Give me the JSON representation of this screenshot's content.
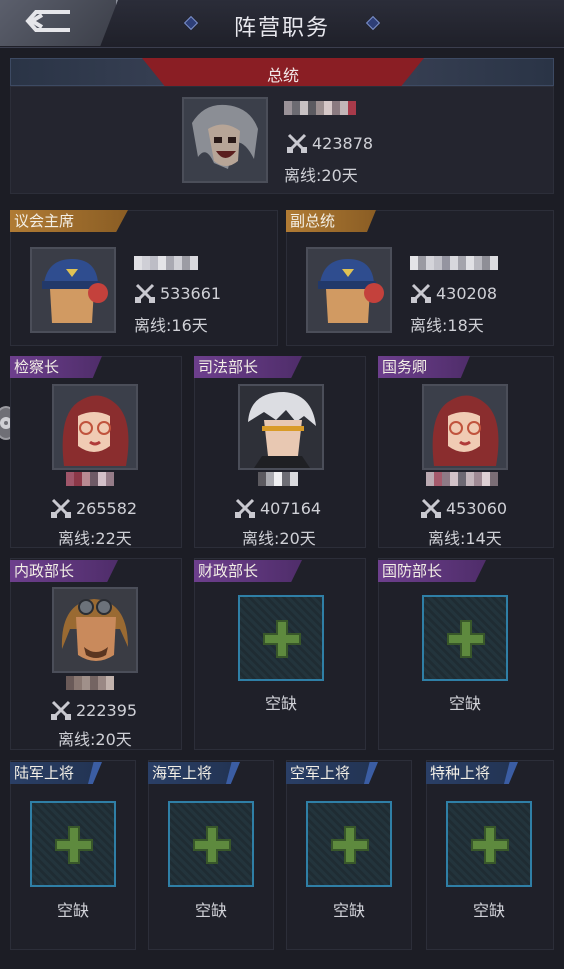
{
  "header": {
    "title": "阵营职务",
    "back_icon": "back-arrow-icon"
  },
  "leader": {
    "title": "总统",
    "power": "423878",
    "offline": "离线:20天"
  },
  "council": [
    {
      "role": "议会主席",
      "power": "533661",
      "offline": "离线:16天"
    },
    {
      "role": "副总统",
      "power": "430208",
      "offline": "离线:18天"
    }
  ],
  "ministers": [
    {
      "role": "检察长",
      "power": "265582",
      "offline": "离线:22天"
    },
    {
      "role": "司法部长",
      "power": "407164",
      "offline": "离线:20天"
    },
    {
      "role": "国务卿",
      "power": "453060",
      "offline": "离线:14天"
    },
    {
      "role": "内政部长",
      "power": "222395",
      "offline": "离线:20天"
    },
    {
      "role": "财政部长",
      "vacant": "空缺"
    },
    {
      "role": "国防部长",
      "vacant": "空缺"
    }
  ],
  "generals": [
    {
      "role": "陆军上将",
      "vacant": "空缺"
    },
    {
      "role": "海军上将",
      "vacant": "空缺"
    },
    {
      "role": "空军上将",
      "vacant": "空缺"
    },
    {
      "role": "特种上将",
      "vacant": "空缺"
    }
  ],
  "colors": {
    "accent_red": "#8a1e24",
    "vacant_border": "#2f7fa6",
    "plus_green": "#5e8a3e"
  }
}
